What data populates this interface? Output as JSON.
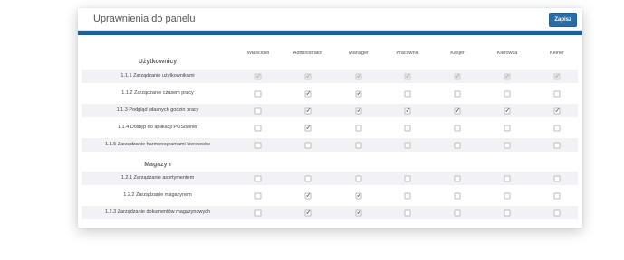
{
  "panel": {
    "title": "Uprawnienia do panelu",
    "save_label": "Zapisz"
  },
  "columns": [
    "Właściciel",
    "Administrator",
    "Manager",
    "Pracownik",
    "Kasjer",
    "Kierowca",
    "Kelner"
  ],
  "sections": [
    {
      "title": "Użytkownicy",
      "rows": [
        {
          "label": "1.1.1 Zarządzanie użytkownikami",
          "disabled": true,
          "checks": [
            true,
            true,
            true,
            true,
            true,
            true,
            true
          ]
        },
        {
          "label": "1.1.2 Zarządzanie czasem pracy",
          "disabled": false,
          "checks": [
            false,
            true,
            true,
            false,
            false,
            false,
            false
          ]
        },
        {
          "label": "1.1.3 Podgląd własnych godzin pracy",
          "disabled": false,
          "checks": [
            false,
            true,
            true,
            true,
            true,
            true,
            true
          ]
        },
        {
          "label": "1.1.4 Dostęp do aplikacji POSowner",
          "disabled": false,
          "checks": [
            false,
            true,
            false,
            false,
            false,
            false,
            false
          ]
        },
        {
          "label": "1.1.5 Zarządzanie harmonogramami kierowców",
          "disabled": false,
          "checks": [
            false,
            false,
            false,
            false,
            false,
            false,
            false
          ]
        }
      ]
    },
    {
      "title": "Magazyn",
      "rows": [
        {
          "label": "1.2.1 Zarządzanie asortymentem",
          "disabled": false,
          "checks": [
            false,
            false,
            false,
            false,
            false,
            false,
            false
          ]
        },
        {
          "label": "1.2.2 Zarządzanie magazynem",
          "disabled": false,
          "checks": [
            false,
            true,
            true,
            false,
            false,
            false,
            false
          ]
        },
        {
          "label": "1.2.3 Zarządzanie dokumentów magazynowych",
          "disabled": false,
          "checks": [
            false,
            true,
            true,
            false,
            false,
            false,
            false
          ]
        }
      ]
    }
  ]
}
